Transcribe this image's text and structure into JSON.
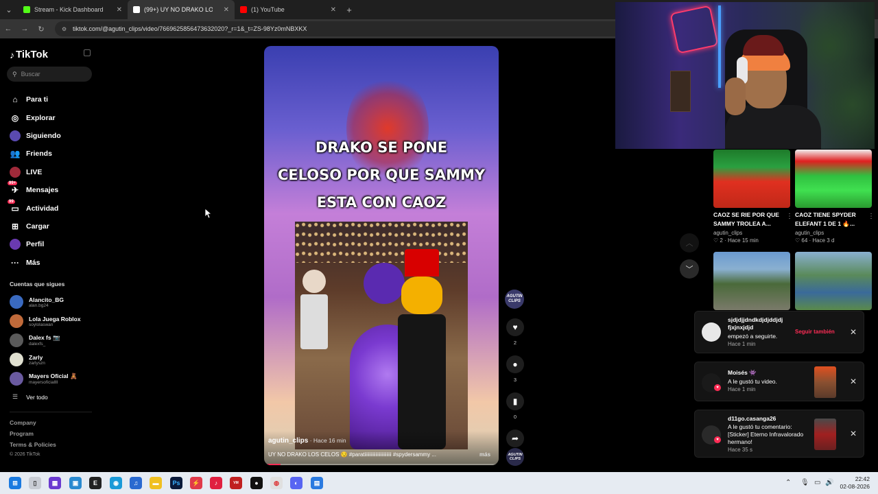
{
  "browser": {
    "tabs": [
      {
        "title": "Stream - Kick Dashboard",
        "favicon_color": "#53fc18",
        "active": false
      },
      {
        "title": "(99+) UY NO DRAKO LOS C...",
        "favicon_color": "#ffffff",
        "active": true
      },
      {
        "title": "(1) YouTube",
        "favicon_color": "#ff0000",
        "active": false
      }
    ],
    "url": "tiktok.com/@agutin_clips/video/7669625856473632020?_r=1&_t=ZS-98Yz0mNBXKX"
  },
  "tiktok": {
    "logo": "TikTok",
    "search_placeholder": "Buscar",
    "nav": [
      {
        "label": "Para ti",
        "icon": "home-icon"
      },
      {
        "label": "Explorar",
        "icon": "compass-icon"
      },
      {
        "label": "Siguiendo",
        "icon": "following-icon"
      },
      {
        "label": "Friends",
        "icon": "friends-icon"
      },
      {
        "label": "LIVE",
        "icon": "live-icon"
      },
      {
        "label": "Mensajes",
        "icon": "messages-icon",
        "badge": "99+"
      },
      {
        "label": "Actividad",
        "icon": "activity-icon",
        "badge": "99"
      },
      {
        "label": "Cargar",
        "icon": "upload-icon"
      },
      {
        "label": "Perfil",
        "icon": "profile-icon"
      },
      {
        "label": "Más",
        "icon": "more-icon"
      }
    ],
    "following_heading": "Cuentas que sigues",
    "following": [
      {
        "name": "Alancito_BG",
        "handle": "alan.bg24",
        "color": "#3a6ac0"
      },
      {
        "name": "Lola Juega Roblox",
        "handle": "soylolaswan",
        "color": "#c06a3a"
      },
      {
        "name": "Dalex fs 📷",
        "handle": "dalexfs_",
        "color": "#5a5a5a"
      },
      {
        "name": "Zarly",
        "handle": "zarlyszn",
        "color": "#e0e0d0"
      },
      {
        "name": "Mayers Oficial 🧸",
        "handle": "mayersoficiallll",
        "color": "#6a5aa0"
      }
    ],
    "see_all": "Ver todo",
    "footer": [
      "Company",
      "Program",
      "Terms & Policies"
    ],
    "copyright": "© 2026 TikTok"
  },
  "video": {
    "caption_lines": [
      "DRAKO SE PONE",
      "CELOSO POR QUE SAMMY",
      "ESTA CON CAOZ"
    ],
    "author": "agutin_clips",
    "time": " · Hace 16 min",
    "description": "UY NO DRAKO LOS CELOS 😏 #paratiiiiiiiiiiiiiiiiiiiiii #spydersammy ...",
    "more": "más",
    "progress": 0.07,
    "author_badge": "AGUTIN CLIPS",
    "likes": "2",
    "comments": "3",
    "saves": "0",
    "shares": "1"
  },
  "recommendations": [
    {
      "title_lines": [
        "CAOZ SE RIE POR QUE",
        "SAMMY TROLEA A..."
      ],
      "author": "agutin_clips",
      "meta": "♡ 2 · Hace 15 min"
    },
    {
      "title_lines": [
        "CAOZ TIENE SPYDER",
        "ELEFANT 1 DE 1 🔥..."
      ],
      "author": "agutin_clips",
      "meta": "♡ 64 · Hace 3 d"
    }
  ],
  "notifications": [
    {
      "user_lines": [
        "sjdjdjjdndkdjdjddjdj",
        "fjxjnxjdjd"
      ],
      "text": "empezó a seguirte.",
      "time": "Hace 1 min",
      "action": "Seguir también"
    },
    {
      "user": "Moisés 👾",
      "text": "A le gustó tu video.",
      "time": "Hace 1 min"
    },
    {
      "user": "d11go.casanga26",
      "text_lines": [
        "A le gustó tu comentario:",
        "[Sticker] Eterno Infravalorado",
        "hermano!"
      ],
      "time": "Hace 35 s"
    }
  ],
  "taskbar": {
    "time": "22:42",
    "date": "02-08-2026"
  }
}
